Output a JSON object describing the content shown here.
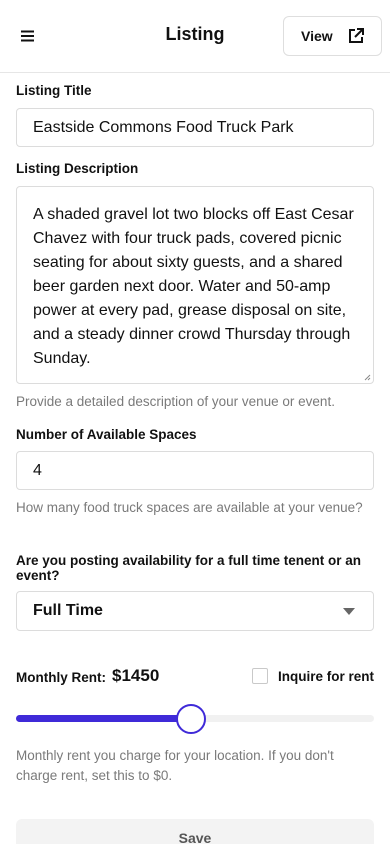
{
  "header": {
    "title": "Listing",
    "view_label": "View",
    "menu_icon": "hamburger-menu-icon",
    "view_icon": "external-link-icon"
  },
  "form": {
    "listing_title": {
      "label": "Listing Title",
      "value": "Eastside Commons Food Truck Park"
    },
    "listing_description": {
      "label": "Listing Description",
      "value": "A shaded gravel lot two blocks off East Cesar Chavez with four truck pads, covered picnic seating for about sixty guests, and a shared beer garden next door. Water and 50-amp power at every pad, grease disposal on site, and a steady dinner crowd Thursday through Sunday.",
      "help": "Provide a detailed description of your venue or event."
    },
    "available_spaces": {
      "label": "Number of Available Spaces",
      "value": "4",
      "help": "How many food truck spaces are available at your venue?"
    },
    "availability_type": {
      "label": "Are you posting availability for a full time tenent or an event?",
      "selected": "Full Time"
    },
    "rent": {
      "label": "Monthly Rent:",
      "value_display": "$1450",
      "slider_fraction": 0.49,
      "inquire_label": "Inquire for rent",
      "inquire_checked": false,
      "help": "Monthly rent you charge for your location. If you don't charge rent, set this to $0."
    },
    "save_label": "Save"
  },
  "colors": {
    "accent": "#3f2ad8",
    "help_text": "#7a7a7a",
    "border": "#dcdcdc"
  }
}
